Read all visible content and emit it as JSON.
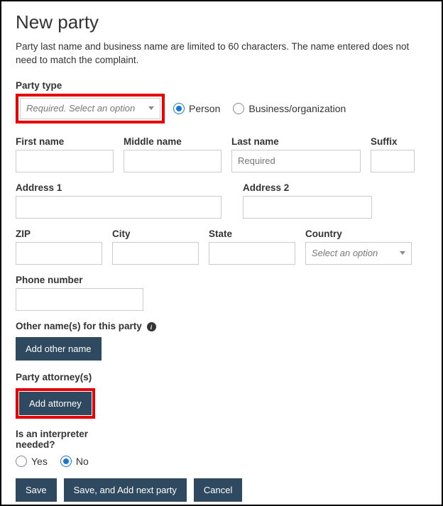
{
  "title": "New party",
  "description": "Party last name and business name are limited to 60 characters. The name entered does not need to match the complaint.",
  "partyType": {
    "label": "Party type",
    "placeholder": "Required. Select an option",
    "optionPerson": "Person",
    "optionBusiness": "Business/organization",
    "selected": "person"
  },
  "name": {
    "firstLabel": "First name",
    "middleLabel": "Middle name",
    "lastLabel": "Last name",
    "lastPlaceholder": "Required",
    "suffixLabel": "Suffix"
  },
  "address": {
    "addr1Label": "Address 1",
    "addr2Label": "Address 2",
    "zipLabel": "ZIP",
    "cityLabel": "City",
    "stateLabel": "State",
    "countryLabel": "Country",
    "countryPlaceholder": "Select an option"
  },
  "phoneLabel": "Phone number",
  "otherNames": {
    "label": "Other name(s) for this party",
    "addBtn": "Add other name"
  },
  "attorneys": {
    "label": "Party attorney(s)",
    "addBtn": "Add attorney"
  },
  "interpreter": {
    "label": "Is an interpreter needed?",
    "yes": "Yes",
    "no": "No",
    "selected": "no"
  },
  "buttons": {
    "save": "Save",
    "saveNext": "Save, and Add next party",
    "cancel": "Cancel"
  }
}
